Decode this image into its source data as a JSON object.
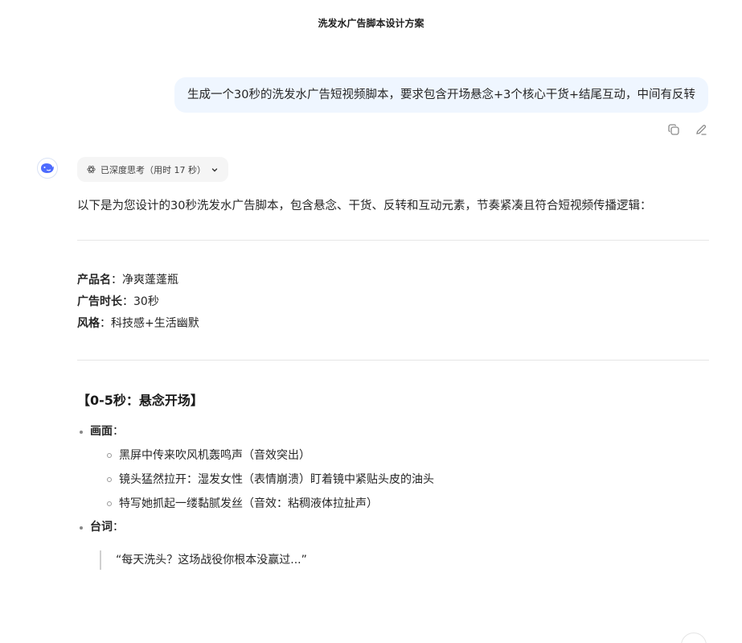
{
  "conversation": {
    "title": "洗发水广告脚本设计方案"
  },
  "user_message": {
    "text": "生成一个30秒的洗发水广告短视频脚本，要求包含开场悬念+3个核心干货+结尾互动，中间有反转"
  },
  "assistant": {
    "think_chip": "已深度思考（用时 17 秒）",
    "intro": "以下是为您设计的30秒洗发水广告脚本，包含悬念、干货、反转和互动元素，节奏紧凑且符合短视频传播逻辑：",
    "meta": [
      {
        "label": "产品名",
        "value": "：净爽蓬蓬瓶"
      },
      {
        "label": "广告时长",
        "value": "：30秒"
      },
      {
        "label": "风格",
        "value": "：科技感+生活幽默"
      }
    ],
    "section": {
      "title": "【0-5秒：悬念开场】",
      "scene_label": "画面",
      "scene_colon": "：",
      "scene_items": [
        "黑屏中传来吹风机轰鸣声（音效突出）",
        "镜头猛然拉开：湿发女性（表情崩溃）盯着镜中紧贴头皮的油头",
        "特写她抓起一缕黏腻发丝（音效：粘稠液体拉扯声）"
      ],
      "line_label": "台词",
      "line_colon": "：",
      "quote": "“每天洗头？这场战役你根本没赢过...”"
    }
  },
  "icons": {
    "copy": "copy-icon",
    "edit": "edit-icon",
    "avatar": "whale-logo-icon",
    "think": "atom-icon",
    "chevron": "chevron-down-icon"
  },
  "colors": {
    "user_bubble": "#eff6ff",
    "brand": "#4d6bfe"
  }
}
